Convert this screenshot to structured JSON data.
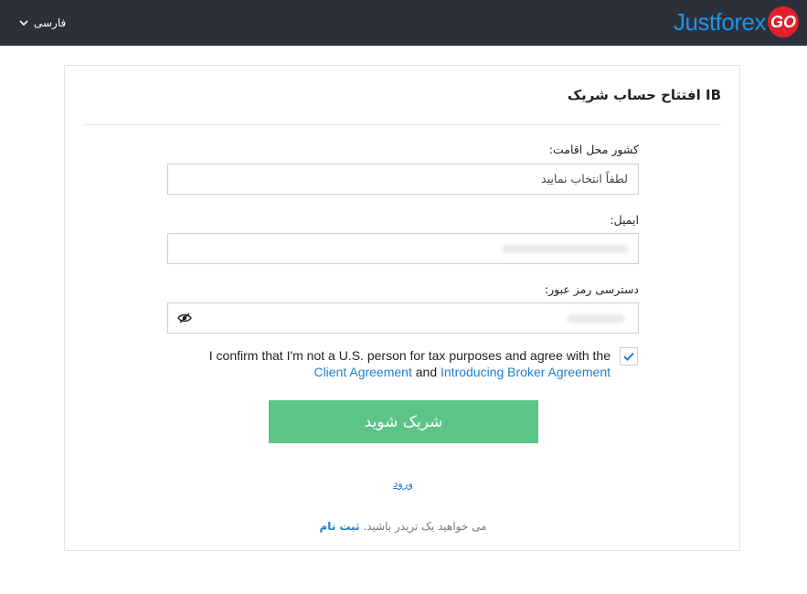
{
  "header": {
    "language": "فارسی",
    "logo_text": "Justforex",
    "logo_badge": "GO",
    "logo_colors": {
      "text": "#1f93e6",
      "badge": "#e2202c"
    },
    "background": "#2b303b"
  },
  "form": {
    "title": "IB افتتاح حساب شریک",
    "country_label": "کشور محل اقامت:",
    "country_value": "لطفاً انتخاب نمایید",
    "email_label": "ایمیل:",
    "password_label": "دسترسی رمز عبور:",
    "consent_prefix": "I confirm that I'm not a U.S. person for tax purposes and agree with the ",
    "consent_link1": "Client Agreement",
    "consent_and": " and ",
    "consent_link2": "Introducing Broker Agreement",
    "consent_checked": true,
    "submit_label": "شریک شوید",
    "submit_color": "#5bc486",
    "login_link": "ورود",
    "register_text": "می خواهید یک تریدر باشید.",
    "register_link": "ثبت نام"
  }
}
